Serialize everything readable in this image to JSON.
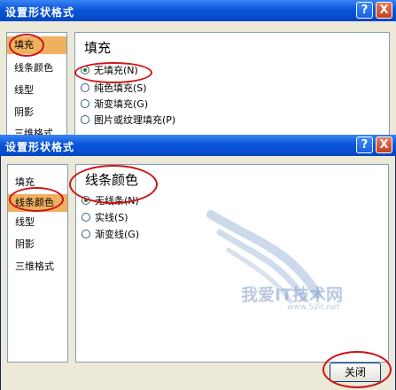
{
  "dialog_top": {
    "title": "设置形状格式",
    "help_label": "?",
    "close_label": "X",
    "nav": [
      "填充",
      "线条颜色",
      "线型",
      "阴影",
      "三维格式"
    ],
    "selected_nav": "填充",
    "heading": "填充",
    "options": [
      "无填充(N)",
      "纯色填充(S)",
      "渐变填充(G)",
      "图片或纹理填充(P)"
    ],
    "selected_option": "无填充(N)"
  },
  "dialog_bottom": {
    "title": "设置形状格式",
    "help_label": "?",
    "close_label": "X",
    "nav": [
      "填充",
      "线条颜色",
      "线型",
      "阴影",
      "三维格式"
    ],
    "selected_nav": "线条颜色",
    "heading": "线条颜色",
    "options": [
      "无线条(N)",
      "实线(S)",
      "渐变线(G)"
    ],
    "selected_option": "无线条(N)",
    "close_button": "关闭"
  },
  "watermark": {
    "text": "我爱IT技术网",
    "url": "www.52it.net"
  },
  "colors": {
    "titlebar": "#0a56d8",
    "dialog_bg": "#ece9d8",
    "nav_selected": "#f0b060",
    "annotation": "#cc1414"
  }
}
